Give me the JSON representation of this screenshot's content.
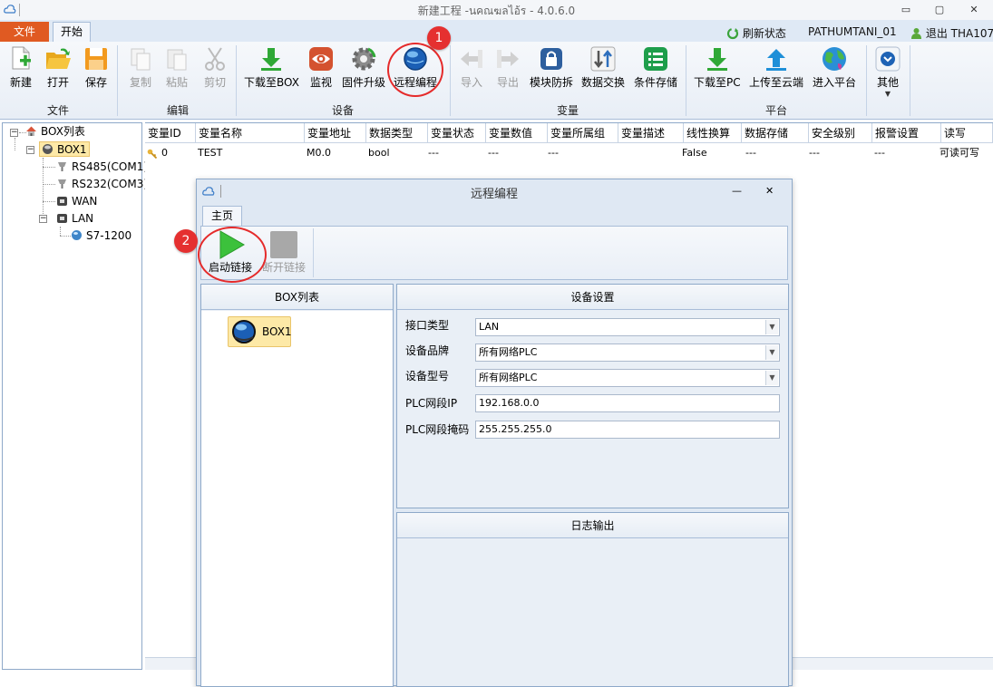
{
  "window": {
    "title": "新建工程 -นคณฆลไอ้ร - 4.0.6.0",
    "minimize": "▭",
    "restore": "▢",
    "close": "✕"
  },
  "tabs": {
    "file": "文件",
    "home": "开始"
  },
  "tabrow_right": {
    "refresh": "刷新状态",
    "user": "PATHUMTANI_01",
    "logout": "退出 THA107"
  },
  "ribbon": {
    "buttons": {
      "new": "新建",
      "open": "打开",
      "save": "保存",
      "copy": "复制",
      "paste": "粘贴",
      "cut": "剪切",
      "download_box": "下载至BOX",
      "monitor": "监视",
      "firmware": "固件升级",
      "remote_prog": "远程编程",
      "import": "导入",
      "export": "导出",
      "module_guard": "模块防拆",
      "data_exchange": "数据交换",
      "cond_storage": "条件存储",
      "download_pc": "下载至PC",
      "upload_cloud": "上传至云端",
      "enter_platform": "进入平台",
      "other": "其他"
    },
    "groups": {
      "file": "文件",
      "edit": "编辑",
      "device": "设备",
      "variable": "变量",
      "platform": "平台"
    }
  },
  "tree": {
    "root": "BOX列表",
    "box": "BOX1",
    "rs485": "RS485(COM1)",
    "rs232": "RS232(COM3)",
    "wan": "WAN",
    "lan": "LAN",
    "plc": "S7-1200"
  },
  "grid": {
    "headers": [
      "变量ID",
      "变量名称",
      "变量地址",
      "数据类型",
      "变量状态",
      "变量数值",
      "变量所属组",
      "变量描述",
      "线性换算",
      "数据存储",
      "安全级别",
      "报警设置",
      "读写"
    ],
    "row": [
      "0",
      "TEST",
      "M0.0",
      "bool",
      "---",
      "---",
      "---",
      "",
      "False",
      "---",
      "---",
      "---",
      "可读可写"
    ]
  },
  "dialog": {
    "title": "远程编程",
    "tab": "主页",
    "start_link": "启动链接",
    "disconnect": "断开链接",
    "box_panel_title": "BOX列表",
    "box_item": "BOX1",
    "settings_title": "设备设置",
    "fields": {
      "iface_label": "接口类型",
      "iface_value": "LAN",
      "brand_label": "设备品牌",
      "brand_value": "所有网络PLC",
      "model_label": "设备型号",
      "model_value": "所有网络PLC",
      "ip_label": "PLC网段IP",
      "ip_value": "192.168.0.0",
      "mask_label": "PLC网段掩码",
      "mask_value": "255.255.255.0"
    },
    "log_title": "日志输出",
    "minimize": "—",
    "close": "✕"
  },
  "annotations": {
    "one": "1",
    "two": "2"
  },
  "colors": {
    "file_tab": "#e05a22",
    "annotation": "#e52b2b",
    "accent": "#2e6fbd"
  }
}
